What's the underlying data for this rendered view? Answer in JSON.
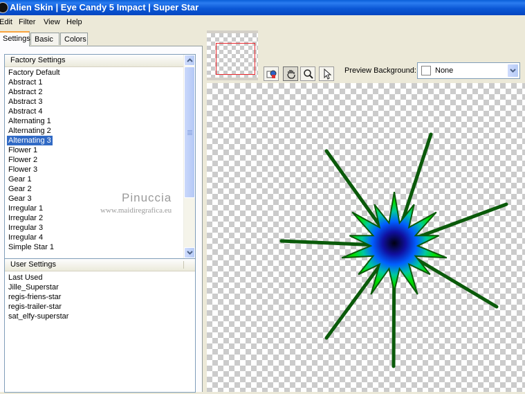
{
  "window": {
    "title": "Alien Skin | Eye Candy 5 Impact | Super Star"
  },
  "menu": [
    "Edit",
    "Filter",
    "View",
    "Help"
  ],
  "tabs": [
    {
      "label": "Settings",
      "active": true
    },
    {
      "label": "Basic",
      "active": false
    },
    {
      "label": "Colors",
      "active": false
    }
  ],
  "factory_settings": {
    "header": "Factory Settings",
    "items": [
      "Factory Default",
      "Abstract 1",
      "Abstract 2",
      "Abstract 3",
      "Abstract 4",
      "Alternating 1",
      "Alternating 2",
      "Alternating 3",
      "Flower 1",
      "Flower 2",
      "Flower 3",
      "Gear 1",
      "Gear 2",
      "Gear 3",
      "Irregular 1",
      "Irregular 2",
      "Irregular 3",
      "Irregular 4",
      "Simple Star 1"
    ],
    "selected": "Alternating 3"
  },
  "user_settings": {
    "header": "User Settings",
    "items": [
      "Last Used",
      "Jille_Superstar",
      "regis-friens-star",
      "regis-trailer-star",
      "sat_elfy-superstar"
    ]
  },
  "watermark": {
    "name": "Pinuccia",
    "url": "www.maidiregrafica.eu"
  },
  "preview": {
    "background_label": "Preview Background:",
    "background_value": "None",
    "tools": [
      "preview-toggle-icon",
      "hand-icon",
      "zoom-icon",
      "pointer-icon"
    ]
  },
  "colors": {
    "title_bar": "#0a5fd8",
    "selection": "#316ac5",
    "star_outer": "#00c800",
    "star_edge": "#0a5a0a",
    "star_core": "#000080",
    "view_rect": "#e8262b"
  }
}
